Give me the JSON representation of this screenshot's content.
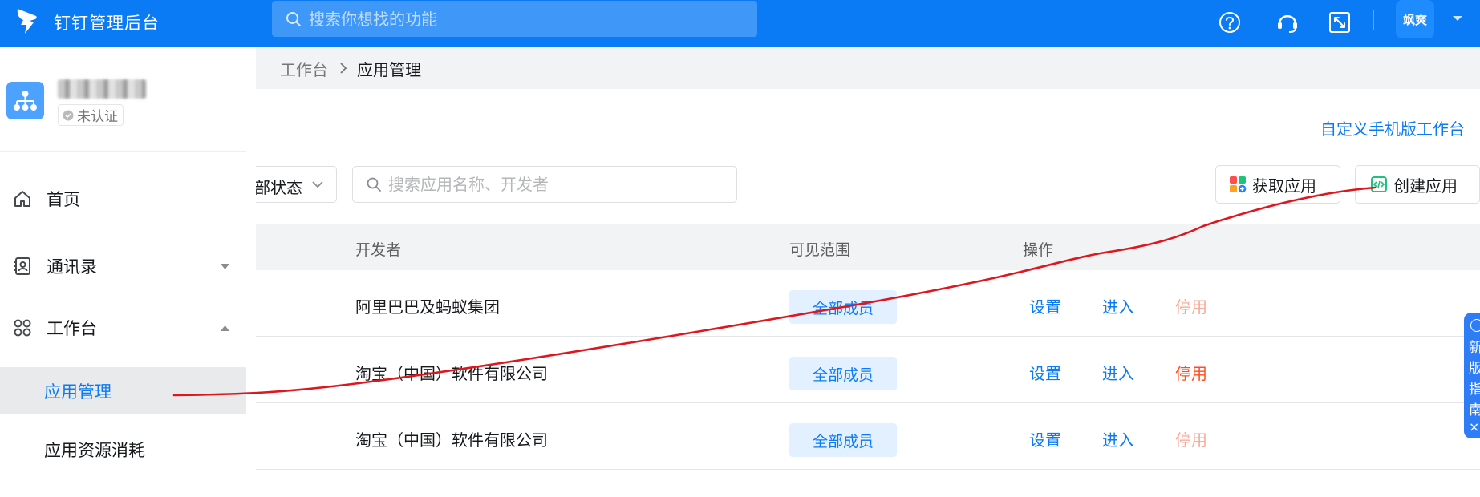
{
  "header": {
    "app_title": "钉钉管理后台",
    "search_placeholder": "搜索你想找的功能",
    "user_avatar_text": "飒爽",
    "colors": {
      "bar": "#0a7af5",
      "text": "#ffffff"
    },
    "icons": [
      "dingtalk-logo-icon",
      "search-icon",
      "help-icon",
      "headset-icon",
      "fullscreen-icon",
      "caret-down-icon"
    ]
  },
  "sidebar": {
    "org": {
      "verification": "未认证"
    },
    "items": [
      {
        "label": "首页",
        "icon": "home-icon"
      },
      {
        "label": "通讯录",
        "icon": "contacts-icon",
        "expanded": false
      },
      {
        "label": "工作台",
        "icon": "workbench-grid-icon",
        "expanded": true
      }
    ],
    "sub_items": [
      {
        "label": "应用管理",
        "active": true
      },
      {
        "label": "应用资源消耗",
        "active": false
      }
    ]
  },
  "main": {
    "breadcrumb": {
      "parent": "工作台",
      "current": "应用管理"
    },
    "custom_mobile_link": "自定义手机版工作台",
    "filters": {
      "status_select_value": "全部状态",
      "search_placeholder": "搜索应用名称、开发者"
    },
    "buttons": {
      "get_app": "获取应用",
      "create_app": "创建应用"
    },
    "table": {
      "headers": [
        "开发者",
        "可见范围",
        "操作"
      ],
      "rows": [
        {
          "developer": "阿里巴巴及蚂蚁集团",
          "scope": "全部成员",
          "actions": [
            "设置",
            "进入",
            "停用"
          ],
          "disable_enabled": false
        },
        {
          "developer": "淘宝（中国）软件有限公司",
          "scope": "全部成员",
          "actions": [
            "设置",
            "进入",
            "停用"
          ],
          "disable_enabled": true
        },
        {
          "developer": "淘宝（中国）软件有限公司",
          "scope": "全部成员",
          "actions": [
            "设置",
            "进入",
            "停用"
          ],
          "disable_enabled": false
        }
      ]
    },
    "floating_guide": {
      "text": "新版指南",
      "close_symbol": "×"
    }
  },
  "colors": {
    "accent": "#0a7af5",
    "disable_active": "#ff4d1f",
    "disable_inactive": "#f7a592",
    "annotation_stroke": "#e0161e"
  }
}
